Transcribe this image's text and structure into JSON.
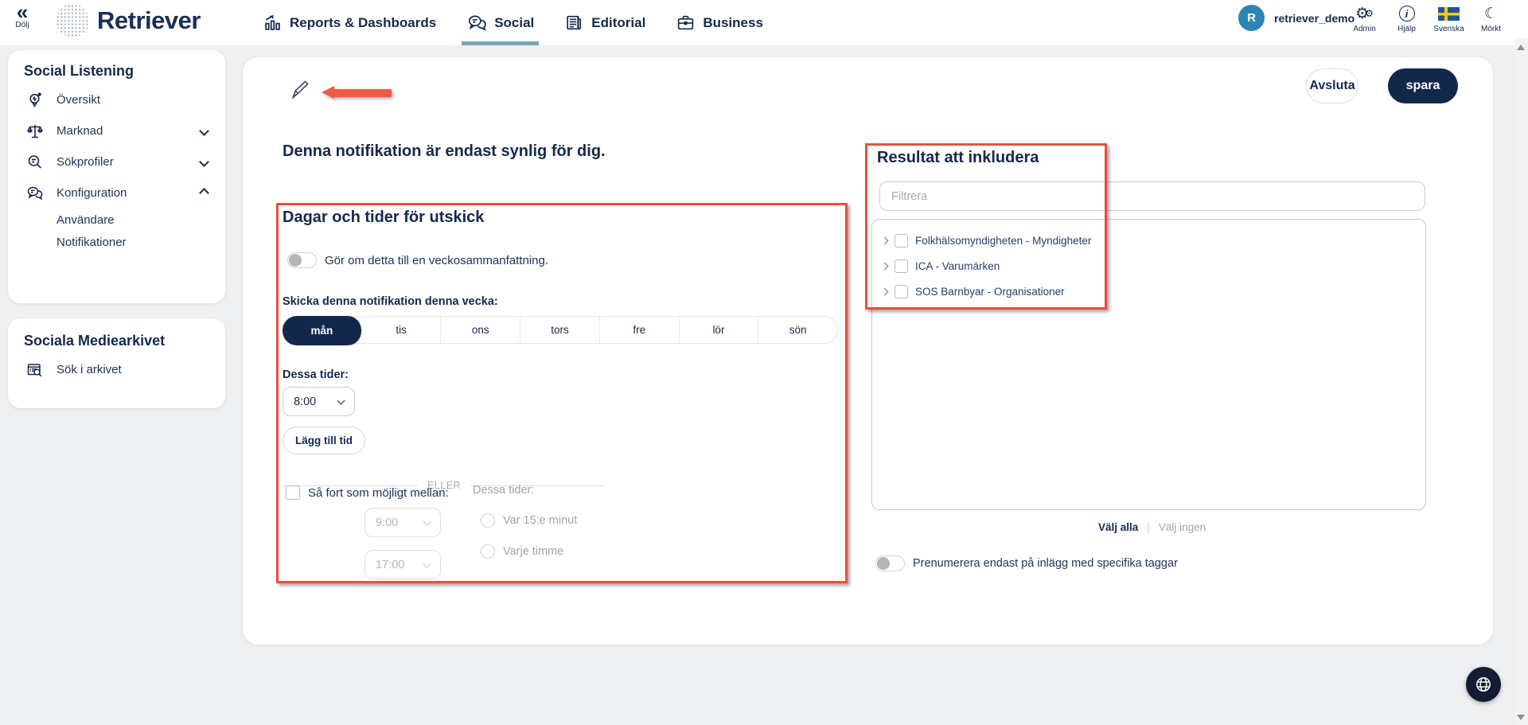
{
  "header": {
    "collapse": {
      "glyph": "«",
      "label": "Dölj"
    },
    "brand": "Retriever",
    "nav": [
      {
        "label": "Reports & Dashboards",
        "active": false
      },
      {
        "label": "Social",
        "active": true
      },
      {
        "label": "Editorial",
        "active": false
      },
      {
        "label": "Business",
        "active": false
      }
    ],
    "user": {
      "initial": "R",
      "name": "retriever_demo"
    },
    "actions": [
      {
        "label": "Admin",
        "icon": "gears-icon"
      },
      {
        "label": "Hjälp",
        "icon": "info-icon"
      },
      {
        "label": "Svenska",
        "icon": "swedish-flag-icon"
      },
      {
        "label": "Mörkt",
        "icon": "moon-icon",
        "glyph": "☾"
      }
    ]
  },
  "sidebar": {
    "social_listening": {
      "title": "Social Listening",
      "items": [
        {
          "label": "Översikt",
          "icon": "lightbulb-icon"
        },
        {
          "label": "Marknad",
          "icon": "scales-icon",
          "chevron": "down"
        },
        {
          "label": "Sökprofiler",
          "icon": "search-profile-icon",
          "chevron": "down"
        },
        {
          "label": "Konfiguration",
          "icon": "chat-bubbles-icon",
          "chevron": "up"
        }
      ],
      "subitems": [
        {
          "label": "Användare"
        },
        {
          "label": "Notifikationer"
        }
      ]
    },
    "archive": {
      "title": "Sociala Mediearkivet",
      "item": {
        "label": "Sök i arkivet",
        "icon": "archive-search-icon"
      }
    }
  },
  "main": {
    "buttons": {
      "cancel": "Avsluta",
      "save": "spara"
    },
    "visibility_note": "Denna notifikation är endast synlig för dig.",
    "schedule": {
      "title": "Dagar och tider för utskick",
      "weekly_toggle_label": "Gör om detta till en veckosammanfattning.",
      "weekly_toggle_on": false,
      "send_week_label": "Skicka denna notifikation denna vecka:",
      "days": [
        "mån",
        "tis",
        "ons",
        "tors",
        "fre",
        "lör",
        "sön"
      ],
      "selected_day": "mån",
      "times_label": "Dessa tider:",
      "time_value": "8:00",
      "add_time_label": "Lägg till tid",
      "or_label": "ELLER",
      "asap_checkbox_label": "Så fort som möjligt mellan:",
      "asap_checked": false,
      "asap_from": "9:00",
      "asap_to": "17:00",
      "asap_times_label": "Dessa tider:",
      "radio_options": [
        "Var 15:e minut",
        "Varje timme"
      ]
    },
    "results": {
      "title": "Resultat att inkludera",
      "filter_placeholder": "Filtrera",
      "items": [
        {
          "label": "Folkhälsomyndigheten - Myndigheter"
        },
        {
          "label": "ICA - Varumärken"
        },
        {
          "label": "SOS Barnbyar - Organisationer"
        }
      ],
      "select_all": "Välj alla",
      "select_separator": "|",
      "select_none": "Välj ingen",
      "tags_toggle_label": "Prenumerera endast på inlägg med specifika taggar",
      "tags_toggle_on": false
    }
  },
  "colors": {
    "navy": "#14294e",
    "teal_underline": "#79a7b4",
    "annotation_red": "#e8503c",
    "avatar_blue": "#2d85b5",
    "selected_day_bg": "#12284b",
    "page_bg": "#eff0f1"
  }
}
